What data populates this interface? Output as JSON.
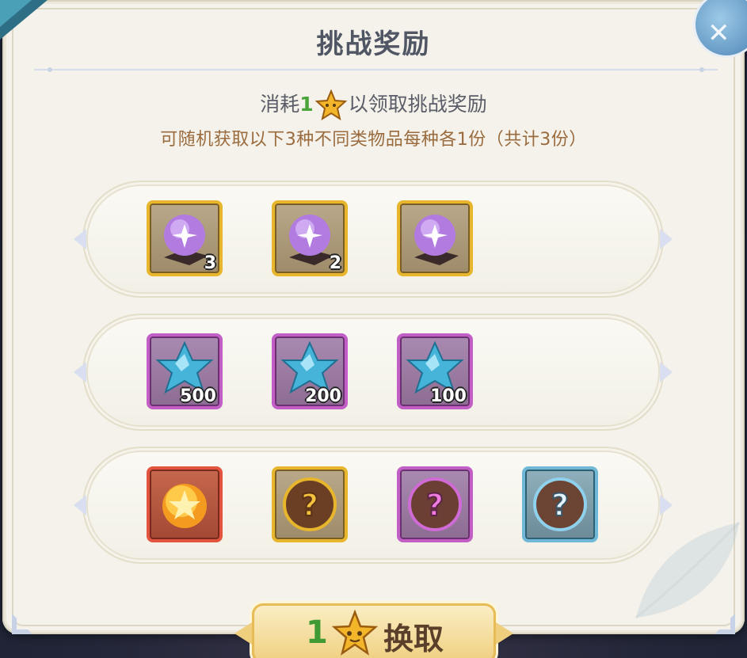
{
  "dialog": {
    "title": "挑战奖励",
    "cost_prefix": "消耗",
    "cost_amount": "1",
    "cost_suffix": "以领取挑战奖励",
    "subtitle": "可随机获取以下3种不同类物品每种各1份（共计3份）",
    "close_icon": "close-icon"
  },
  "rows": [
    {
      "items": [
        {
          "icon": "purple-crystal-orb-icon",
          "frame": "gold",
          "qty": "3"
        },
        {
          "icon": "purple-crystal-orb-icon",
          "frame": "gold",
          "qty": "2"
        },
        {
          "icon": "purple-crystal-orb-icon",
          "frame": "gold",
          "qty": ""
        }
      ]
    },
    {
      "items": [
        {
          "icon": "blue-crystal-star-icon",
          "frame": "purple",
          "qty": "500"
        },
        {
          "icon": "blue-crystal-star-icon",
          "frame": "purple",
          "qty": "200"
        },
        {
          "icon": "blue-crystal-star-icon",
          "frame": "purple",
          "qty": "100"
        }
      ]
    },
    {
      "items": [
        {
          "icon": "golden-star-orb-icon",
          "frame": "red",
          "qty": ""
        },
        {
          "icon": "mystery-question-gold-icon",
          "frame": "gold",
          "qty": ""
        },
        {
          "icon": "mystery-question-purple-icon",
          "frame": "purple",
          "qty": ""
        },
        {
          "icon": "mystery-question-blue-icon",
          "frame": "blue",
          "qty": ""
        }
      ]
    }
  ],
  "exchange_button": {
    "amount": "1",
    "label": "换取",
    "icon": "star-token-icon"
  },
  "colors": {
    "gold_frame": "#e8b62c",
    "purple_frame": "#c25fc7",
    "red_frame": "#e2543d",
    "blue_frame": "#6fb8d8",
    "green_text": "#4aa43a",
    "subtitle_text": "#9a6b3e"
  }
}
